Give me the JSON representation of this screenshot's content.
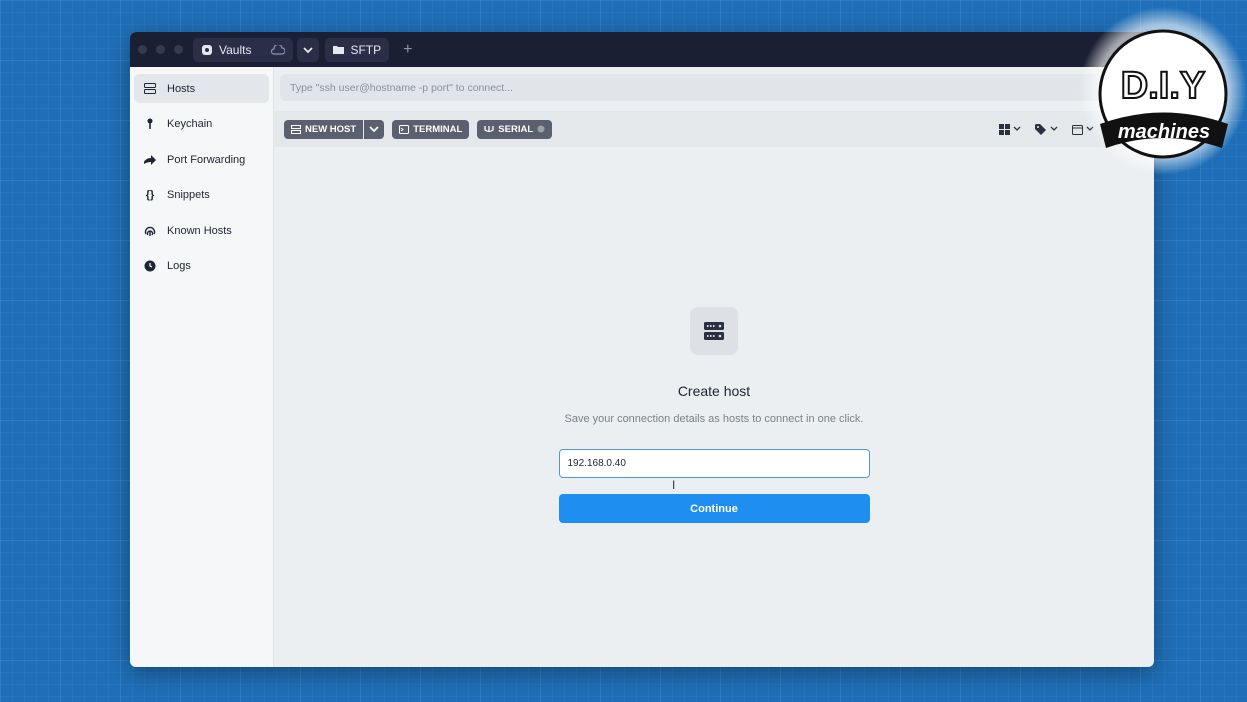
{
  "tabs": {
    "vaults_label": "Vaults",
    "sftp_label": "SFTP",
    "new_tab": "+"
  },
  "sidebar": {
    "items": [
      {
        "label": "Hosts",
        "icon": "server-icon"
      },
      {
        "label": "Keychain",
        "icon": "key-icon"
      },
      {
        "label": "Port Forwarding",
        "icon": "forward-arrow-icon"
      },
      {
        "label": "Snippets",
        "icon": "braces-icon"
      },
      {
        "label": "Known Hosts",
        "icon": "fingerprint-icon"
      },
      {
        "label": "Logs",
        "icon": "clock-icon"
      }
    ]
  },
  "address_bar": {
    "placeholder": "Type \"ssh user@hostname -p port\" to connect..."
  },
  "toolbar": {
    "new_host": "NEW HOST",
    "terminal": "TERMINAL",
    "serial": "SERIAL"
  },
  "create_host": {
    "title": "Create host",
    "subtitle": "Save your connection details as hosts to connect in one click.",
    "input_value": "192.168.0.40",
    "continue_label": "Continue"
  },
  "logo": {
    "line1": "D.I.Y",
    "line2": "machines"
  },
  "colors": {
    "accent": "#1e8ff0",
    "titlebar": "#1b1f33",
    "background": "#1f6fb8"
  }
}
